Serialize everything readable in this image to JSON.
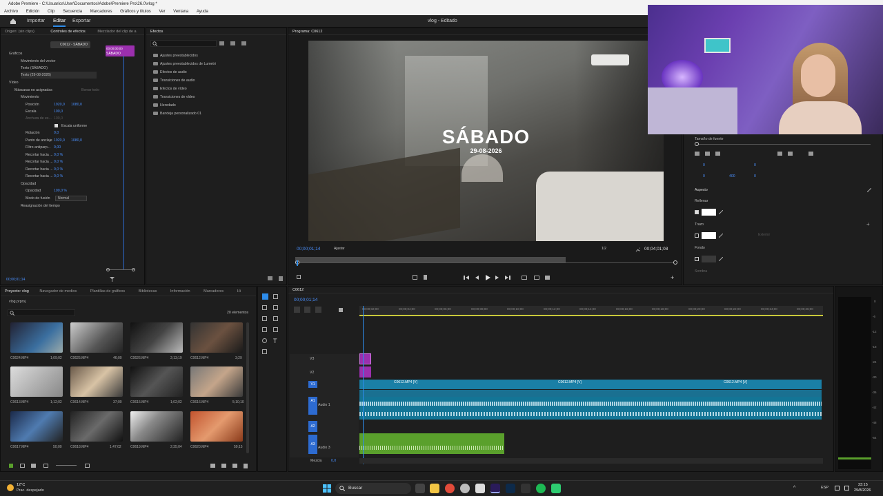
{
  "window": {
    "title": "Adobe Premiere - C:\\Usuarios\\User\\Documentos\\Adobe\\Premiere Pro\\26.0\\vlog *",
    "menu": [
      "Archivo",
      "Edición",
      "Clip",
      "Secuencia",
      "Marcadores",
      "Gráficos y títulos",
      "Ver",
      "Ventana",
      "Ayuda"
    ]
  },
  "appbar": {
    "workspaces": [
      "Importar",
      "Editar",
      "Exportar"
    ],
    "project_status": "vlog - Editado"
  },
  "effect_controls": {
    "tabs": [
      "Origen: (sin clips)",
      "Controles de efectos",
      "Mezclador del clip de a"
    ],
    "clip_selector": "C0612 - SÁBADO",
    "timecode_tag": "00;00;00;00",
    "clip_label": "SÁBADO",
    "sections": {
      "graphics": "Gráficos",
      "video": "Vídeo"
    },
    "graphic_items": [
      "Movimiento del vector",
      "Texto (SÁBADO)",
      "Texto (29-08-2026)"
    ],
    "masks_label": "Máscaras no asignadas",
    "masks_action": "Borrar todo",
    "motion": "Movimiento",
    "props": [
      {
        "name": "Posición",
        "v1": "1920,0",
        "v2": "1080,0"
      },
      {
        "name": "Escala",
        "v1": "100,0",
        "v2": ""
      },
      {
        "name": "Anchura de es...",
        "v1": "100,0",
        "v2": ""
      },
      {
        "name": "Escala uniforme",
        "v1": "",
        "v2": ""
      },
      {
        "name": "Rotación",
        "v1": "0,0",
        "v2": ""
      },
      {
        "name": "Punto de anclaje",
        "v1": "1920,0",
        "v2": "1080,0"
      },
      {
        "name": "Filtro antiparp...",
        "v1": "0,00",
        "v2": ""
      },
      {
        "name": "Recortar hacia ...",
        "v1": "0,0 %",
        "v2": ""
      },
      {
        "name": "Recortar hacia ...",
        "v1": "0,0 %",
        "v2": ""
      },
      {
        "name": "Recortar hacia ...",
        "v1": "0,0 %",
        "v2": ""
      },
      {
        "name": "Recortar hacia ...",
        "v1": "0,0 %",
        "v2": ""
      }
    ],
    "opacity": "Opacidad",
    "opacity_value": "100,0 %",
    "blend_label": "Modo de fusión",
    "blend_value": "Normal",
    "time_remap": "Reasignación del tiempo",
    "timecode": "00;00;01;14"
  },
  "effects_panel": {
    "tab": "Efectos",
    "folders": [
      "Ajustes preestablecidos",
      "Ajustes preestablecidos de Lumetri",
      "Efectos de audio",
      "Transiciones de audio",
      "Efectos de vídeo",
      "Transiciones de vídeo",
      "Heredado",
      "Bandeja personalizado 01"
    ]
  },
  "program_monitor": {
    "tab": "Programa: C0612",
    "title_text": "SÁBADO",
    "date_text": "29-08-2026",
    "timecode": "00;00;01;14",
    "fit": "Ajustar",
    "resolution": "1/2",
    "duration": "00;04;01;08"
  },
  "essential_graphics": {
    "font_size_label": "Tamaño de fuente",
    "appearance": "Aspecto",
    "fill": "Rellenar",
    "stroke": "Trazo",
    "stroke_mode": "Exterior",
    "background": "Fondo",
    "shadow": "Sombra",
    "num_a": "0",
    "num_b": "0",
    "num_c": "0",
    "num_d": "400",
    "num_e": "0"
  },
  "project_panel": {
    "tabs": [
      "Proyecto: vlog",
      "Navegador de medios",
      "Plantillas de gráficos",
      "Bibliotecas",
      "Información",
      "Marcadores",
      "Hi"
    ],
    "file": "vlog.prproj",
    "count": "20 elementos",
    "clips": [
      {
        "name": "C0624.MP4",
        "dur": "1;09;02"
      },
      {
        "name": "C0625.MP4",
        "dur": "46;00"
      },
      {
        "name": "C0626.MP4",
        "dur": "2;13;19"
      },
      {
        "name": "C0612.MP4",
        "dur": "3;29"
      },
      {
        "name": "C0613.MP4",
        "dur": "1;12;02"
      },
      {
        "name": "C0614.MP4",
        "dur": "37;00"
      },
      {
        "name": "C0615.MP4",
        "dur": "1;02;02"
      },
      {
        "name": "C0616.MP4",
        "dur": "5;10;10"
      },
      {
        "name": "C0617.MP4",
        "dur": "50;00"
      },
      {
        "name": "C0618.MP4",
        "dur": "1;47;02"
      },
      {
        "name": "C0619.MP4",
        "dur": "2;35;04"
      },
      {
        "name": "C0620.MP4",
        "dur": "59;15"
      }
    ]
  },
  "timeline": {
    "tab": "C0612",
    "timecode": "00;00;01;14",
    "ruler": [
      "00;00;02;00",
      "00;00;04;00",
      "00;00;06;00",
      "00;00;08;00",
      "00;00;10;00",
      "00;00;12;00",
      "00;00;14;00",
      "00;00;16;00",
      "00;00;18;00",
      "00;00;20;00",
      "00;00;22;00",
      "00;00;24;00",
      "00;00;26;00"
    ],
    "tracks": [
      "V3",
      "V2",
      "V1",
      "A1",
      "A2",
      "A3"
    ],
    "audio_names": [
      "Audio 1",
      "Audio 3"
    ],
    "clip_labels": [
      "C0612.MP4 [V]",
      "C0612.MP4 [V]",
      "C0612.MP4 [V]"
    ],
    "mix": "Mezcla",
    "mix_value": "0,0"
  },
  "meter_labels": [
    "0",
    "-6",
    "-12",
    "-18",
    "-24",
    "-30",
    "-36",
    "-42",
    "-48",
    "-54"
  ],
  "taskbar": {
    "weather_temp": "12°C",
    "weather_desc": "Prac. despejado",
    "search": "Buscar",
    "lang": "ESP",
    "time": "23:15",
    "date": "29/8/2026"
  },
  "colors": {
    "accent": "#2d8ceb",
    "video_clip": "#1a7fa6",
    "graphic_clip": "#9b2fae",
    "audio_green": "#5aa02c"
  }
}
